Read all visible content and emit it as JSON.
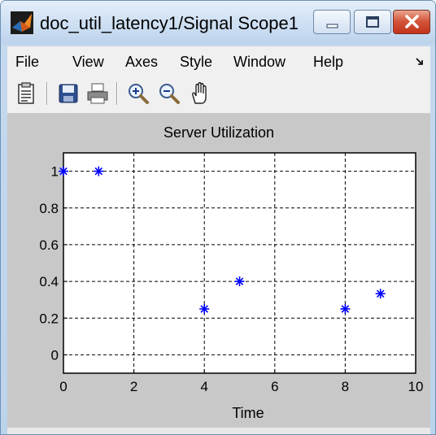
{
  "window": {
    "title": "doc_util_latency1/Signal Scope1",
    "icon": "matlab-icon",
    "controls": [
      "minimize",
      "maximize",
      "close"
    ]
  },
  "menu": {
    "items": [
      "File",
      "View",
      "Axes",
      "Style",
      "Window",
      "Help"
    ],
    "overflow_icon": "menu-arrow-icon"
  },
  "toolbar": {
    "tools": [
      "parameters-icon",
      "save-icon",
      "print-icon",
      "zoom-in-icon",
      "zoom-out-icon",
      "pan-hand-icon"
    ]
  },
  "colors": {
    "marker": "#0000ff",
    "figure_background": "#c8c8c8",
    "axes_background": "#ffffff"
  },
  "chart_data": {
    "type": "scatter",
    "title": "Server Utilization",
    "xlabel": "Time",
    "ylabel": "",
    "xlim": [
      0,
      10
    ],
    "ylim": [
      -0.1,
      1.1
    ],
    "xticks": [
      0,
      2,
      4,
      6,
      8,
      10
    ],
    "yticks": [
      0,
      0.2,
      0.4,
      0.6,
      0.8,
      1
    ],
    "xtick_labels": [
      "0",
      "2",
      "4",
      "6",
      "8",
      "10"
    ],
    "ytick_labels": [
      "0",
      "0.2",
      "0.4",
      "0.6",
      "0.8",
      "1"
    ],
    "grid": true,
    "marker": "asterisk",
    "series": [
      {
        "x": [
          0,
          1,
          4,
          5,
          8,
          9
        ],
        "y": [
          1,
          1,
          0.25,
          0.4,
          0.25,
          0.333
        ]
      }
    ]
  }
}
